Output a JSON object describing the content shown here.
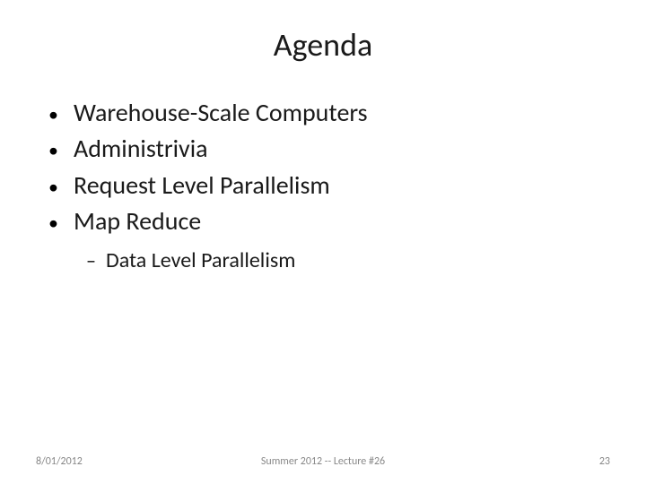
{
  "title": "Agenda",
  "bullets": {
    "b0": "Warehouse-Scale Computers",
    "b1": "Administrivia",
    "b2": "Request Level Parallelism",
    "b3": "Map Reduce"
  },
  "sub": {
    "s0": "Data Level Parallelism"
  },
  "footer": {
    "date": "8/01/2012",
    "center": "Summer 2012 -- Lecture #26",
    "page": "23"
  }
}
